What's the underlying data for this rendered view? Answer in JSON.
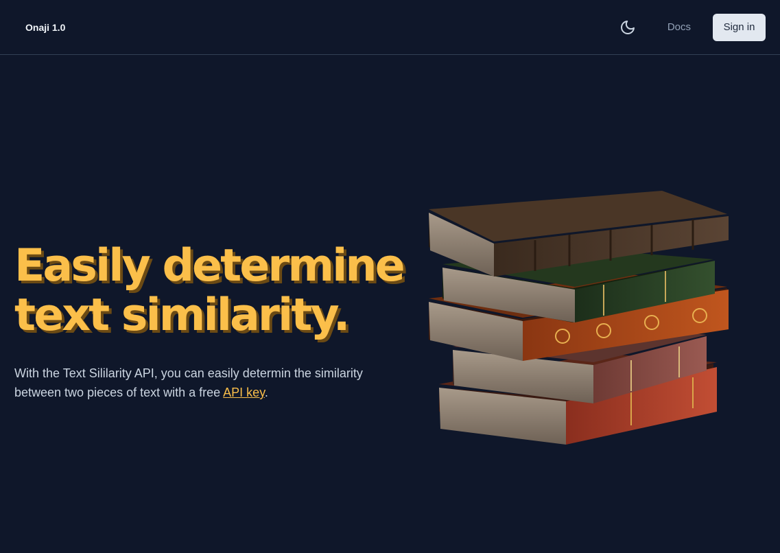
{
  "navbar": {
    "brand": "Onaji 1.0",
    "theme_icon": "moon-icon",
    "docs_label": "Docs",
    "signin_label": "Sign in"
  },
  "hero": {
    "title_line1": "Easily determine",
    "title_line2": "text similarity.",
    "text_before": "With the Text Sililarity API, you can easily determin the similarity between two pieces of text with a free ",
    "link_label": "API key",
    "text_after": ".",
    "image_icon": "book-stack-illustration"
  },
  "colors": {
    "background": "#0f172a",
    "accent": "#fbbf4a",
    "button_bg": "#e2e8f0"
  }
}
